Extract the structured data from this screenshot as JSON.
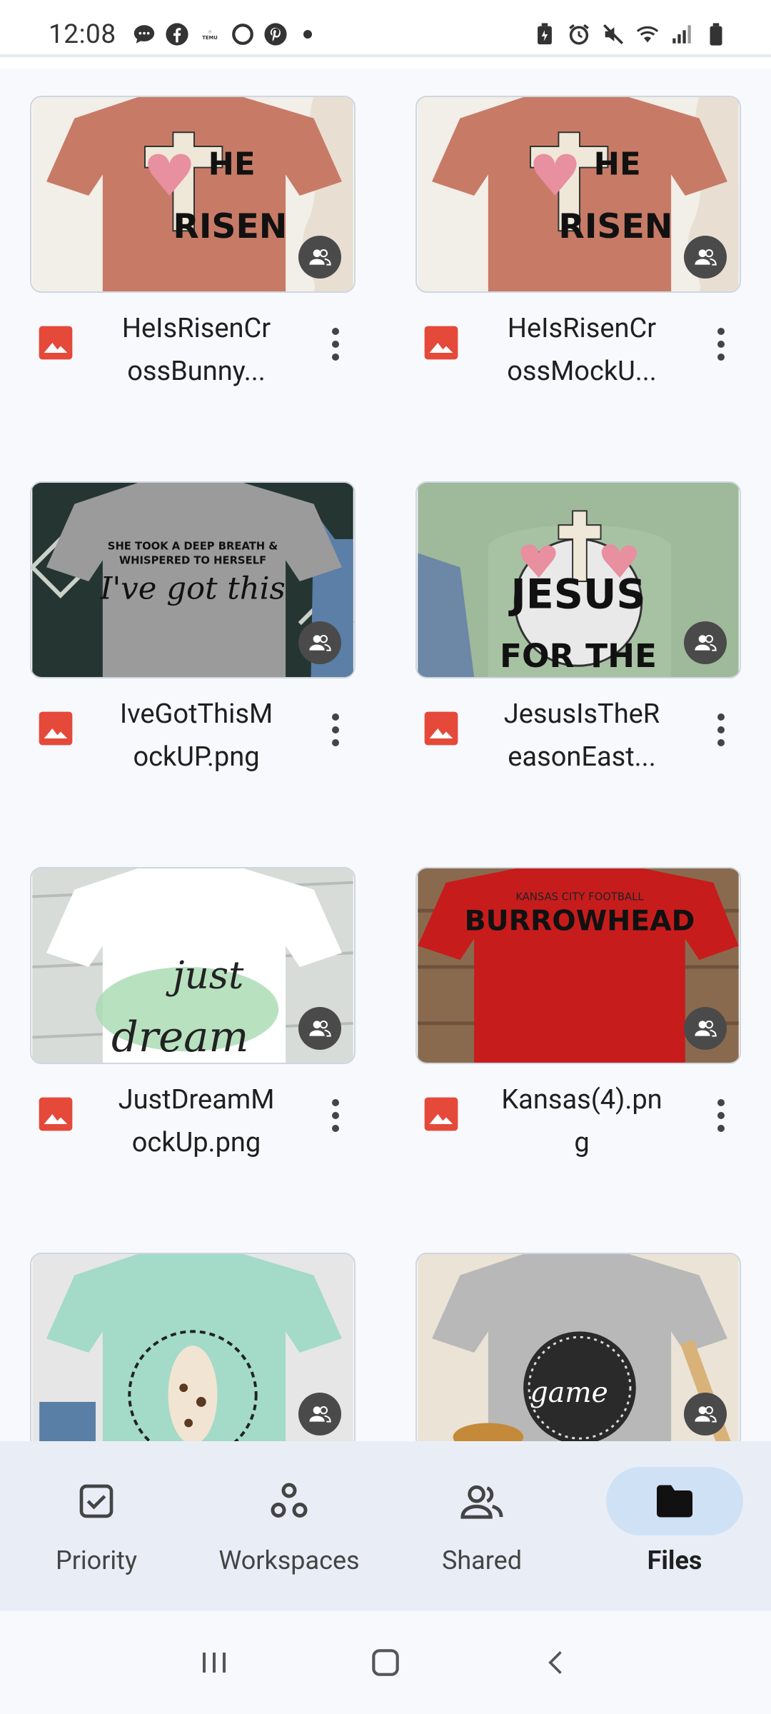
{
  "status_bar": {
    "time": "12:08",
    "left_icons": [
      "chat-icon",
      "facebook-icon",
      "temu-icon",
      "threads-icon",
      "pinterest-icon",
      "dot-icon"
    ],
    "right_icons": [
      "battery-saver-icon",
      "alarm-icon",
      "mute-icon",
      "wifi-icon",
      "signal-icon",
      "battery-icon"
    ]
  },
  "files": [
    {
      "name": "HeIsRisenCr\nossBunny...",
      "type_icon": "image-file-icon",
      "shared": true,
      "shirt_color": "#c77b66",
      "print": "HE IS RISEN"
    },
    {
      "name": "HeIsRisenCr\nossMockU...",
      "type_icon": "image-file-icon",
      "shared": true,
      "shirt_color": "#c77b66",
      "print": "HE IS RISEN"
    },
    {
      "name": "IveGotThisM\nockUP.png",
      "type_icon": "image-file-icon",
      "shared": true,
      "shirt_color": "#9b9b9b",
      "print": "I've got this"
    },
    {
      "name": "JesusIsTheR\neasonEast...",
      "type_icon": "image-file-icon",
      "shared": true,
      "shirt_color": "#9fb99b",
      "print": "JESUS FOR THE"
    },
    {
      "name": "JustDreamM\nockUp.png",
      "type_icon": "image-file-icon",
      "shared": true,
      "shirt_color": "#ffffff",
      "print": "just dream"
    },
    {
      "name": "Kansas(4).pn\ng",
      "type_icon": "image-file-icon",
      "shared": true,
      "shirt_color": "#c71c1c",
      "print": "BURROWHEAD"
    },
    {
      "name": "",
      "type_icon": "image-file-icon",
      "shared": true,
      "shirt_color": "#a3dbc8",
      "print": ""
    },
    {
      "name": "",
      "type_icon": "image-file-icon",
      "shared": true,
      "shirt_color": "#b8b8b8",
      "print": "game day"
    }
  ],
  "bottom_nav": {
    "items": [
      {
        "label": "Priority",
        "icon": "priority-check-icon",
        "active": false
      },
      {
        "label": "Workspaces",
        "icon": "workspaces-icon",
        "active": false
      },
      {
        "label": "Shared",
        "icon": "shared-people-icon",
        "active": false
      },
      {
        "label": "Files",
        "icon": "folder-icon",
        "active": true
      }
    ]
  },
  "system_nav": [
    "recents-icon",
    "home-icon",
    "back-icon"
  ],
  "colors": {
    "accent_pill": "#cfe2f5",
    "nav_bg": "#e9eef6",
    "image_icon_red": "#e5493a"
  }
}
